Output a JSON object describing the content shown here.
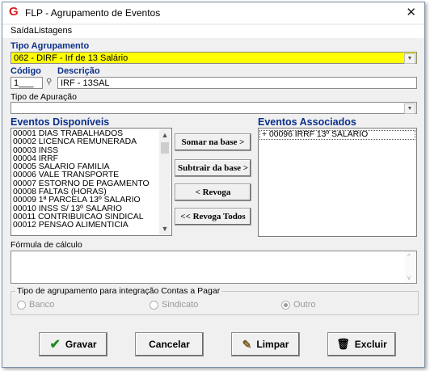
{
  "window": {
    "title": "FLP - Agrupamento de Eventos"
  },
  "menu": [
    "Saída",
    "Listagens"
  ],
  "tipo_agrupamento": {
    "label": "Tipo Agrupamento",
    "value": "062 - DIRF - Irf de 13 Salário"
  },
  "codigo": {
    "label": "Código",
    "value": "1___"
  },
  "descricao": {
    "label": "Descrição",
    "value": "IRF - 13SAL"
  },
  "tipo_apuracao": {
    "label": "Tipo de Apuração",
    "value": ""
  },
  "eventos_disponiveis": {
    "label": "Eventos Disponíveis",
    "items": [
      "00001 DIAS TRABALHADOS",
      "00002 LICENCA REMUNERADA",
      "00003 INSS",
      "00004 IRRF",
      "00005 SALARIO FAMILIA",
      "00006 VALE TRANSPORTE",
      "00007 ESTORNO DE PAGAMENTO",
      "00008 FALTAS (HORAS)",
      "00009 1ª PARCELA 13º SALARIO",
      "00010 INSS S/ 13º SALARIO",
      "00011 CONTRIBUICAO SINDICAL",
      "00012 PENSAO ALIMENTICIA"
    ]
  },
  "eventos_associados": {
    "label": "Eventos Associados",
    "items": [
      "+ 00096 IRRF 13º SALARIO"
    ]
  },
  "buttons": {
    "somar": "Somar na base >",
    "subtrair": "Subtrair da base >",
    "revoga": "< Revoga",
    "revoga_todos": "<< Revoga Todos"
  },
  "formula": {
    "label": "Fórmula de cálculo",
    "value": ""
  },
  "contas_pagar": {
    "label": "Tipo de agrupamento para integração Contas a Pagar",
    "options": [
      "Banco",
      "Sindicato",
      "Outro"
    ],
    "selected": "Outro"
  },
  "footer": {
    "gravar": "Gravar",
    "cancelar": "Cancelar",
    "limpar": "Limpar",
    "excluir": "Excluir"
  },
  "colors": {
    "accent_label": "#0b2f8a",
    "highlight": "#ffff00",
    "gravar_icon": "#1e8a1e"
  }
}
